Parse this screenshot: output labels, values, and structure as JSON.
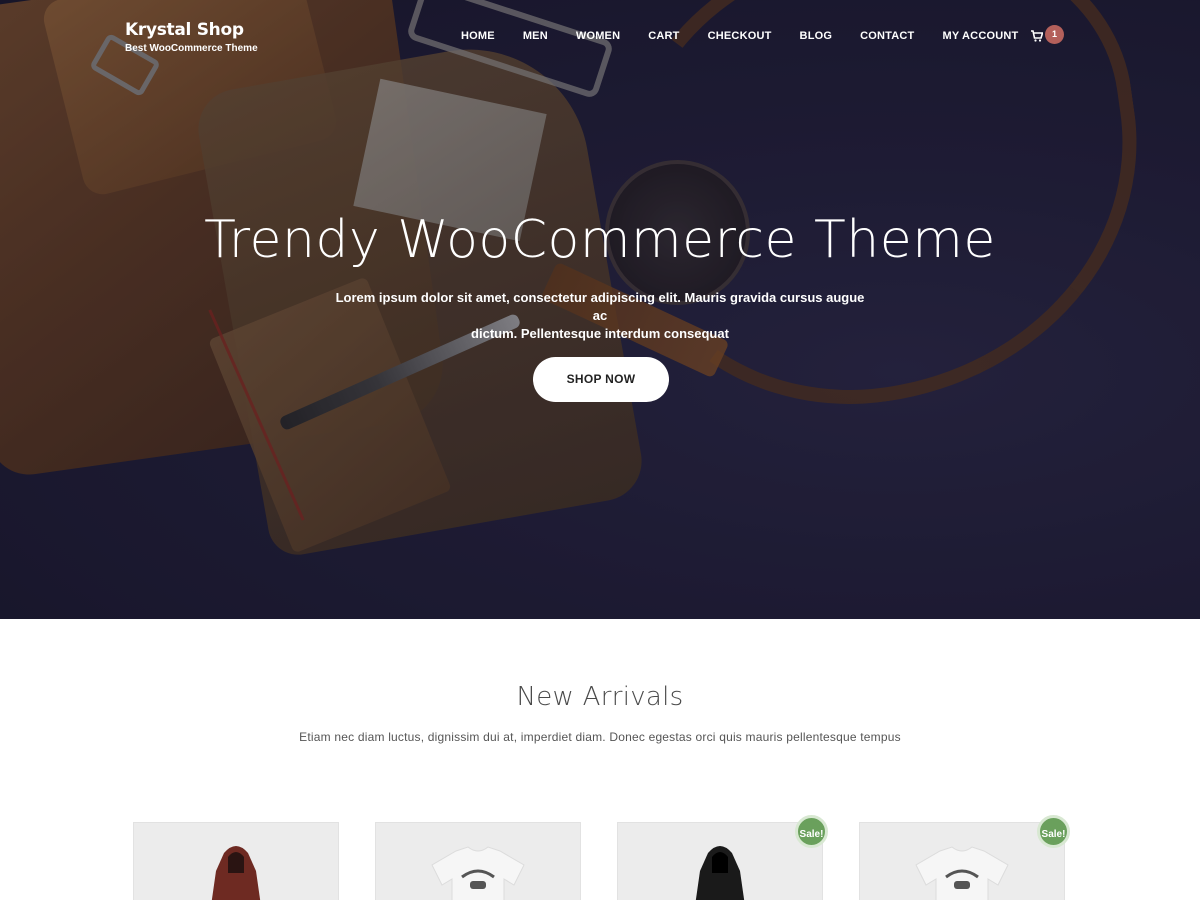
{
  "header": {
    "site_title": "Krystal Shop",
    "tagline": "Best WooCommerce Theme",
    "nav": [
      "HOME",
      "MEN",
      "WOMEN",
      "CART",
      "CHECKOUT",
      "BLOG",
      "CONTACT",
      "MY ACCOUNT"
    ],
    "cart_count": "1",
    "cart_icon": "cart-icon"
  },
  "hero": {
    "title": "Trendy WooCommerce Theme",
    "subtitle_line1": "Lorem ipsum dolor sit amet, consectetur adipiscing elit. Mauris gravida cursus augue ac",
    "subtitle_line2": "dictum. Pellentesque interdum consequat",
    "button": "SHOP NOW"
  },
  "new_arrivals": {
    "title": "New Arrivals",
    "subtitle": "Etiam nec diam luctus, dignissim dui at, imperdiet diam. Donec egestas orci quis mauris pellentesque tempus",
    "products": [
      {
        "image": "red-hoodie",
        "sale_badge": ""
      },
      {
        "image": "white-tshirt",
        "sale_badge": ""
      },
      {
        "image": "black-hoodie",
        "sale_badge": "Sale!"
      },
      {
        "image": "white-tshirt",
        "sale_badge": "Sale!"
      }
    ]
  },
  "colors": {
    "cart_badge": "#b4605b",
    "sale_badge": "#6aa05c",
    "hero_background": "#24223d"
  }
}
